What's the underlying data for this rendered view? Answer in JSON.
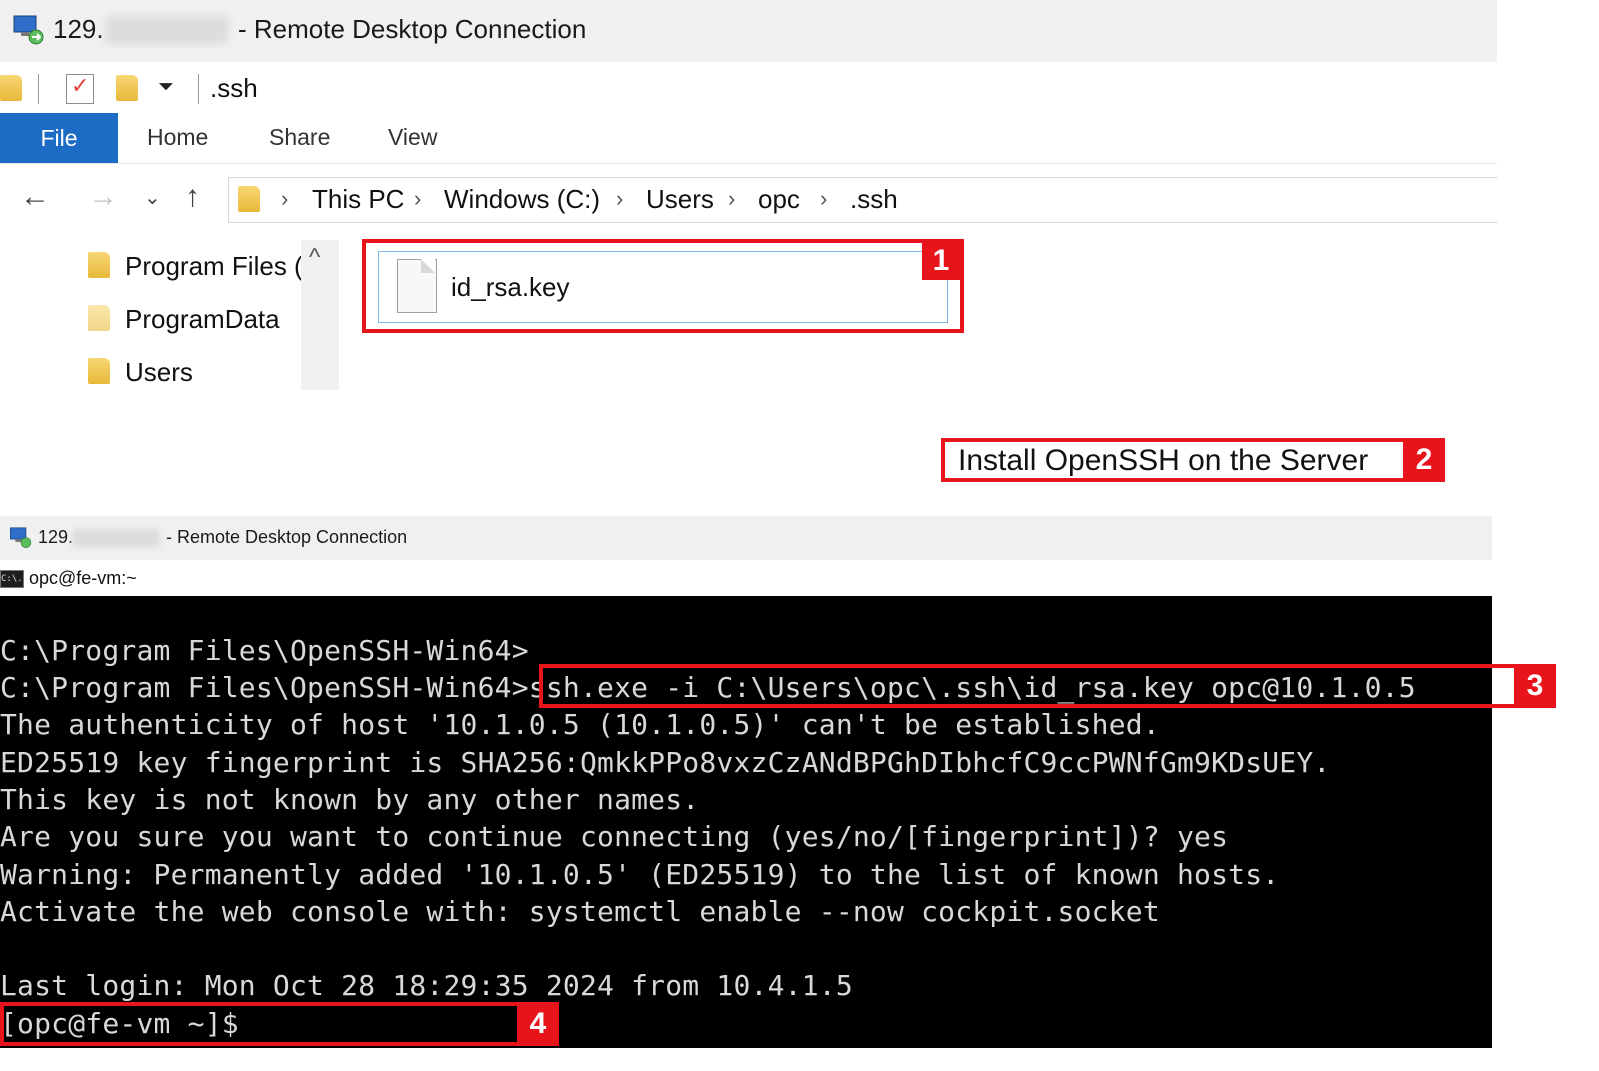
{
  "window_top": {
    "title_prefix": "129.",
    "title_suffix": "- Remote Desktop Connection",
    "quick_access_path": ".ssh",
    "ribbon_tabs": [
      "File",
      "Home",
      "Share",
      "View"
    ],
    "breadcrumb": [
      "This PC",
      "Windows (C:)",
      "Users",
      "opc",
      ".ssh"
    ],
    "nav_tree": [
      "Program Files (",
      "ProgramData",
      "Users"
    ],
    "file_name": "id_rsa.key",
    "callouts": {
      "one": "1",
      "two_label": "Install OpenSSH on the Server",
      "two": "2"
    }
  },
  "window_bottom": {
    "title_prefix": "129.",
    "title_suffix": "- Remote Desktop Connection",
    "cmd_title": "opc@fe-vm:~",
    "cmd_icon_text": "C:\\.",
    "terminal_lines": [
      "C:\\Program Files\\OpenSSH-Win64>",
      "C:\\Program Files\\OpenSSH-Win64>ssh.exe -i C:\\Users\\opc\\.ssh\\id_rsa.key opc@10.1.0.5",
      "The authenticity of host '10.1.0.5 (10.1.0.5)' can't be established.",
      "ED25519 key fingerprint is SHA256:QmkkPPo8vxzCzANdBPGhDIbhcfC9ccPWNfGm9KDsUEY.",
      "This key is not known by any other names.",
      "Are you sure you want to continue connecting (yes/no/[fingerprint])? yes",
      "Warning: Permanently added '10.1.0.5' (ED25519) to the list of known hosts.",
      "Activate the web console with: systemctl enable --now cockpit.socket",
      "",
      "Last login: Mon Oct 28 18:29:35 2024 from 10.4.1.5",
      "[opc@fe-vm ~]$"
    ],
    "callouts": {
      "three": "3",
      "four": "4"
    }
  },
  "colors": {
    "callout_red": "#e8141c",
    "file_tab_blue": "#1c6bc4",
    "terminal_bg": "#000000"
  }
}
